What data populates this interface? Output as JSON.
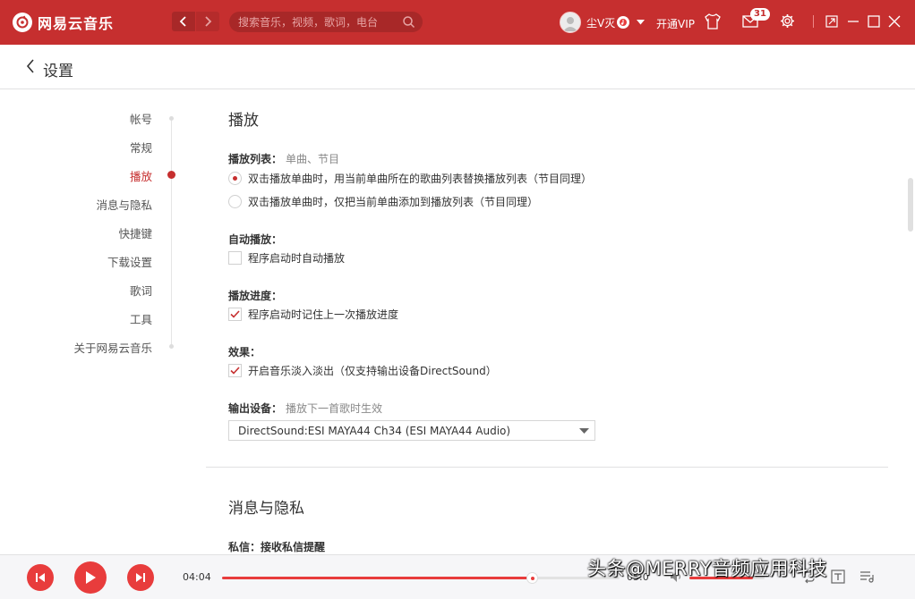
{
  "app": {
    "name": "网易云音乐",
    "search_placeholder": "搜索音乐，视频，歌词，电台",
    "username": "尘V灭",
    "vip_link": "开通VIP",
    "message_count": "31",
    "brand_color": "#c62f2f"
  },
  "page": {
    "title": "设置"
  },
  "sidebar": {
    "items": [
      {
        "label": "帐号"
      },
      {
        "label": "常规"
      },
      {
        "label": "播放",
        "active": true
      },
      {
        "label": "消息与隐私"
      },
      {
        "label": "快捷键"
      },
      {
        "label": "下载设置"
      },
      {
        "label": "歌词"
      },
      {
        "label": "工具"
      },
      {
        "label": "关于网易云音乐"
      }
    ]
  },
  "content": {
    "play_section": {
      "title": "播放",
      "playlist": {
        "label": "播放列表：",
        "hint": "单曲、节目",
        "options": [
          {
            "label": "双击播放单曲时，用当前单曲所在的歌曲列表替换播放列表（节目同理）",
            "selected": true
          },
          {
            "label": "双击播放单曲时，仅把当前单曲添加到播放列表（节目同理）",
            "selected": false
          }
        ]
      },
      "autoplay": {
        "label": "自动播放：",
        "option": "程序启动时自动播放",
        "checked": false
      },
      "progress": {
        "label": "播放进度：",
        "option": "程序启动时记住上一次播放进度",
        "checked": true
      },
      "effect": {
        "label": "效果：",
        "option": "开启音乐淡入淡出（仅支持输出设备DirectSound）",
        "checked": true
      },
      "output": {
        "label": "输出设备：",
        "hint": "播放下一首歌时生效",
        "selected": "DirectSound:ESI MAYA44 Ch34 (ESI MAYA44 Audio)"
      }
    },
    "privacy_section": {
      "title": "消息与隐私",
      "dm": {
        "label": "私信：",
        "hint": "接收私信提醒"
      }
    }
  },
  "player": {
    "current_time": "04:04",
    "progress_fraction": 0.78,
    "volume_fraction": 0.85,
    "total_time": "05:0"
  },
  "watermark": {
    "text": "头条@MERRY音频应用科技"
  }
}
